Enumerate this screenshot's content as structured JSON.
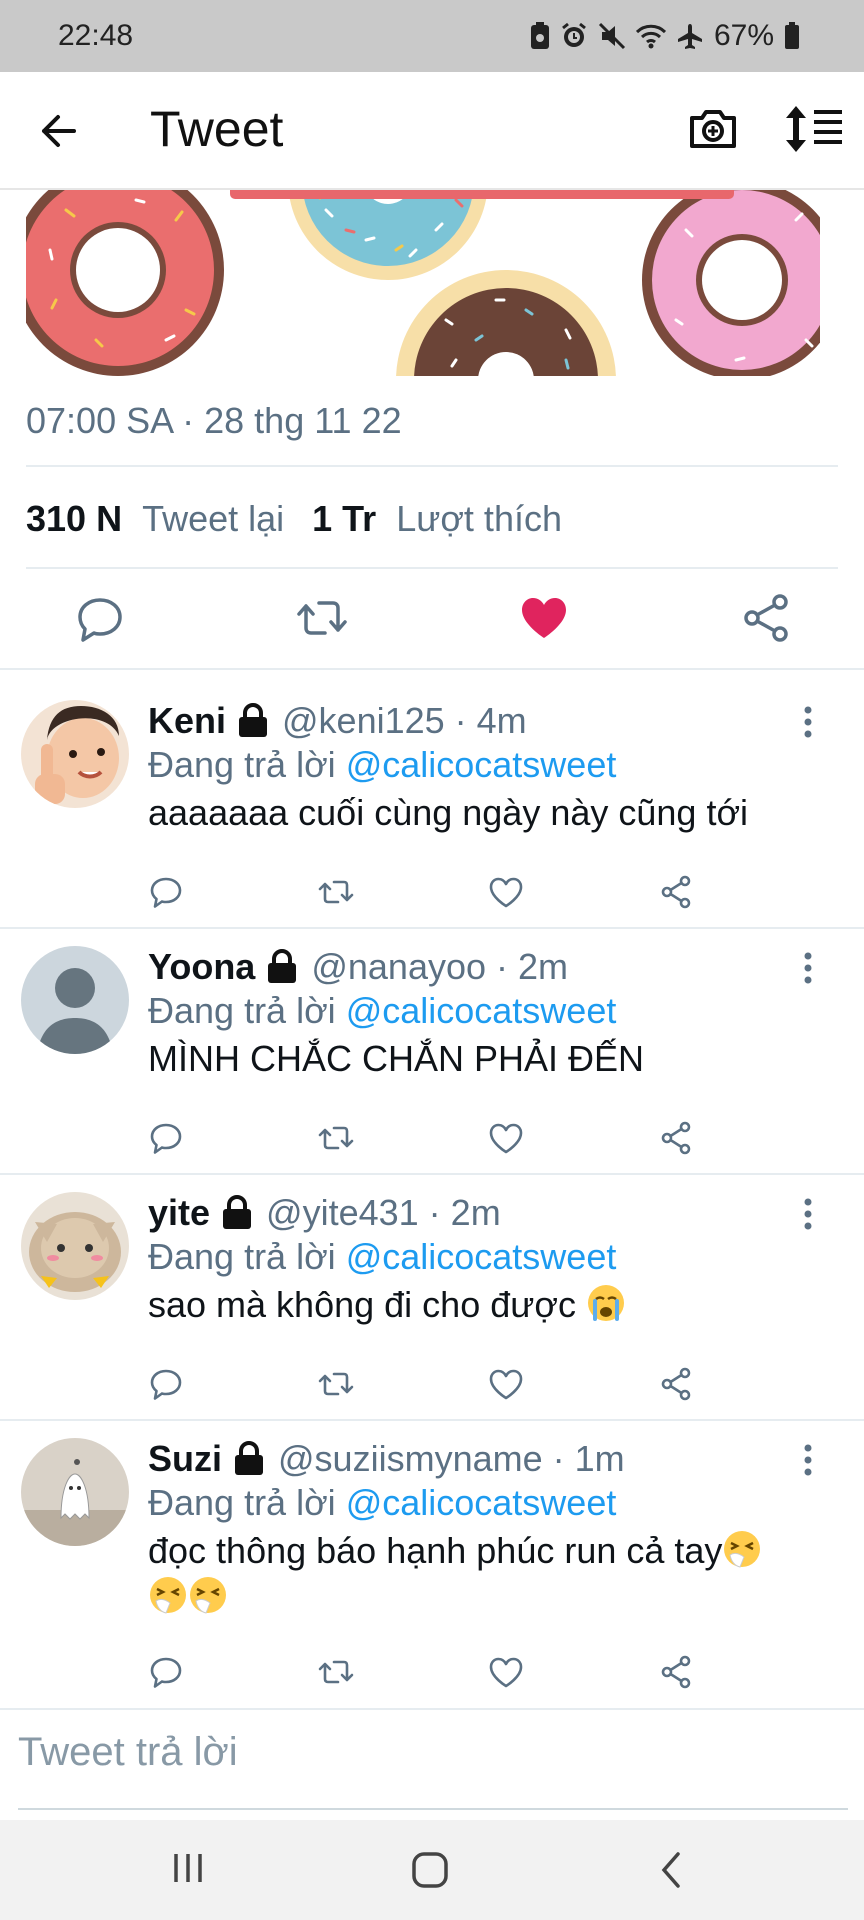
{
  "status_bar": {
    "time": "22:48",
    "battery": "67%",
    "icons": [
      "screenshot-icon",
      "alarm-icon",
      "mute-icon",
      "wifi-icon",
      "airplane-icon",
      "battery-icon"
    ]
  },
  "header": {
    "title": "Tweet",
    "back_icon": "arrow-left-icon",
    "camera_icon": "camera-plus-icon",
    "sort_icon": "sort-icon"
  },
  "tweet": {
    "timestamp": "07:00 SA · 28 thg 11 22",
    "retweets_count": "310 N",
    "retweets_label": "Tweet lại",
    "likes_count": "1 Tr",
    "likes_label": "Lượt thích",
    "liked": true,
    "colors": {
      "like": "#e0245e",
      "accent": "#1d9bf0",
      "muted": "#5b7083"
    }
  },
  "replies": [
    {
      "name": "Keni",
      "meta": "@keni125 · 4m",
      "replying_prefix": "Đang trả lời",
      "replying_to": "@calicocatsweet",
      "text": "aaaaaaa cuối cùng ngày này cũng tới",
      "emojis": []
    },
    {
      "name": "Yoona",
      "meta": "@nanayoo · 2m",
      "replying_prefix": "Đang trả lời",
      "replying_to": "@calicocatsweet",
      "text": "MÌNH CHẮC CHẮN PHẢI ĐẾN",
      "emojis": []
    },
    {
      "name": "yite",
      "meta": "@yite431 · 2m",
      "replying_prefix": "Đang trả lời",
      "replying_to": "@calicocatsweet",
      "text": "sao mà không đi cho được",
      "emojis": [
        "crying-face-emoji"
      ]
    },
    {
      "name": "Suzi",
      "meta": "@suziismyname · 1m",
      "replying_prefix": "Đang trả lời",
      "replying_to": "@calicocatsweet",
      "text": "đọc thông báo hạnh phúc run cả tay",
      "emojis": [
        "sneezing-face-emoji",
        "sneezing-face-emoji",
        "sneezing-face-emoji"
      ]
    }
  ],
  "compose": {
    "placeholder": "Tweet trả lời"
  },
  "nav_bar": {
    "icons": [
      "recents-icon",
      "home-icon",
      "back-icon"
    ]
  }
}
